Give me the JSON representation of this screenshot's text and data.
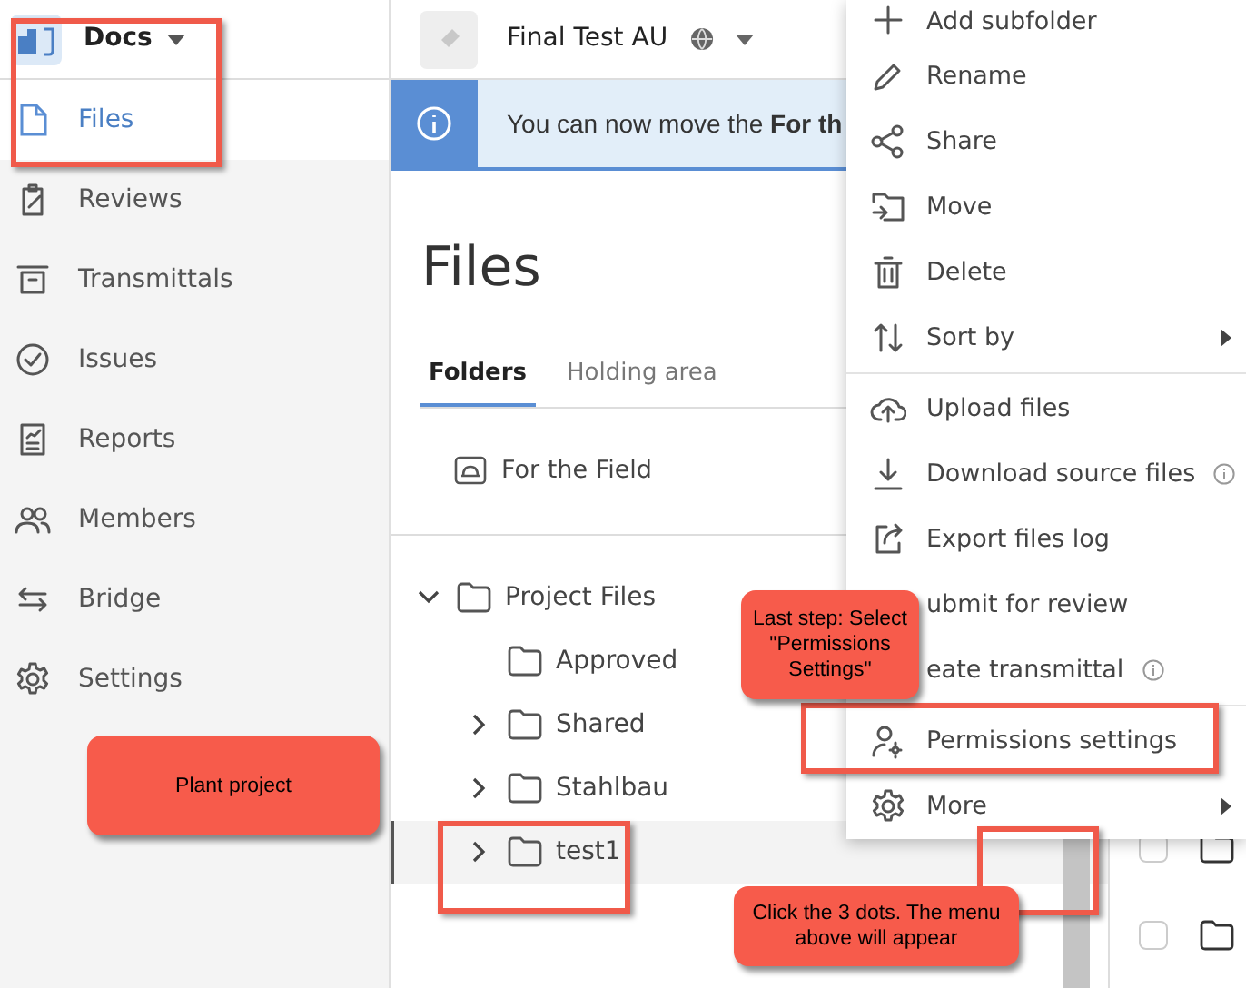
{
  "sidebar": {
    "module": {
      "label": "Docs"
    },
    "items": [
      {
        "label": "Files",
        "kind": "file",
        "selected": true
      },
      {
        "label": "Reviews",
        "kind": "clipboard",
        "selected": false
      },
      {
        "label": "Transmittals",
        "kind": "tray",
        "selected": false
      },
      {
        "label": "Issues",
        "kind": "check",
        "selected": false
      },
      {
        "label": "Reports",
        "kind": "report",
        "selected": false
      },
      {
        "label": "Members",
        "kind": "people",
        "selected": false
      },
      {
        "label": "Bridge",
        "kind": "arrows",
        "selected": false
      },
      {
        "label": "Settings",
        "kind": "gear",
        "selected": false
      }
    ]
  },
  "header": {
    "project": "Final Test AU"
  },
  "banner": {
    "text": "You can now move the **For th**"
  },
  "page_title": "Files",
  "tabs": [
    {
      "label": "Folders",
      "selected": true
    },
    {
      "label": "Holding area",
      "selected": false
    }
  ],
  "field_folder": {
    "label": "For the Field"
  },
  "tree": [
    {
      "label": "Project Files",
      "kind": "expanded",
      "selected": false,
      "children": [
        {
          "label": "Approved",
          "kind": "leaf",
          "selected": false
        },
        {
          "label": "Shared",
          "kind": "collapsed",
          "selected": false
        },
        {
          "label": "Stahlbau",
          "kind": "collapsed",
          "selected": false
        },
        {
          "label": "test1",
          "kind": "collapsed",
          "selected": true
        }
      ]
    }
  ],
  "context_menu": [
    {
      "label": "Add subfolder",
      "kind": "plus",
      "submenu": false,
      "info": false
    },
    {
      "label": "Rename",
      "kind": "pencil",
      "submenu": false,
      "info": false
    },
    {
      "label": "Share",
      "kind": "share",
      "submenu": false,
      "info": false
    },
    {
      "label": "Move",
      "kind": "move",
      "submenu": false,
      "info": false
    },
    {
      "label": "Delete",
      "kind": "trash",
      "submenu": false,
      "info": false
    },
    {
      "label": "Sort by",
      "kind": "sort",
      "submenu": true,
      "info": false,
      "divider_after": true
    },
    {
      "label": "Upload files",
      "kind": "upload",
      "submenu": false,
      "info": false
    },
    {
      "label": "Download source files",
      "kind": "download",
      "submenu": false,
      "info": true
    },
    {
      "label": "Export files log",
      "kind": "export",
      "submenu": false,
      "info": false
    },
    {
      "label": "ubmit for review",
      "kind": "covered",
      "submenu": false,
      "info": false
    },
    {
      "label": "eate transmittal",
      "kind": "covered",
      "submenu": false,
      "info": true,
      "divider_after": true
    },
    {
      "label": "Permissions settings",
      "kind": "usergear",
      "submenu": false,
      "info": false
    },
    {
      "label": "More",
      "kind": "gear",
      "submenu": true,
      "info": false
    }
  ],
  "side_rows": [
    {
      "checked": false
    },
    {
      "checked": false
    }
  ],
  "callouts": [
    {
      "text": "Plant project"
    },
    {
      "text": "Last step: Select \"Permissions Settings\""
    },
    {
      "text": "Click the  3 dots. The menu above will appear"
    }
  ]
}
